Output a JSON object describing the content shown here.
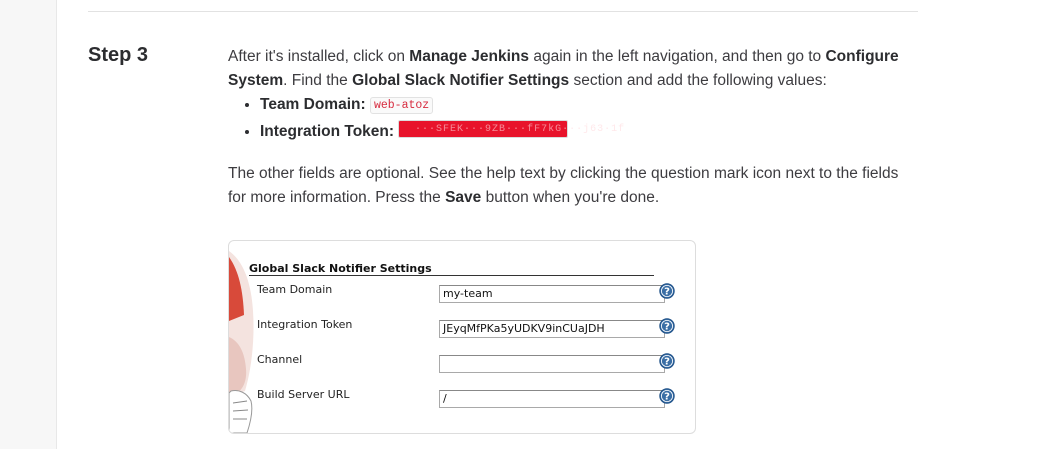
{
  "step": {
    "title": "Step 3",
    "intro": {
      "t1": "After it's installed, click on ",
      "b1": "Manage Jenkins",
      "t2": " again in the left navigation, and then go to ",
      "b2": "Configure System",
      "t3": ". Find the ",
      "b3": "Global Slack Notifier Settings",
      "t4": " section and add the following values:"
    },
    "values": [
      {
        "label": "Team Domain:",
        "code": "web-atoz"
      },
      {
        "label": "Integration Token:",
        "code": "···SFEK···9ZB···fF7kG···j63·1f"
      }
    ],
    "outro": {
      "t1": "The other fields are optional. See the help text by clicking the question mark icon next to the fields for more information. Press the ",
      "b1": "Save",
      "t2": " button when you're done."
    }
  },
  "screenshot": {
    "section_title": "Global Slack Notifier Settings",
    "fields": [
      {
        "label": "Team Domain",
        "value": "my-team"
      },
      {
        "label": "Integration Token",
        "value": "JEyqMfPKa5yUDKV9inCUaJDH"
      },
      {
        "label": "Channel",
        "value": ""
      },
      {
        "label": "Build Server URL",
        "value": "/"
      }
    ]
  },
  "colors": {
    "code_text": "#d72b3f",
    "redaction": "#e8132b",
    "help_icon": "#3a6ea5"
  }
}
